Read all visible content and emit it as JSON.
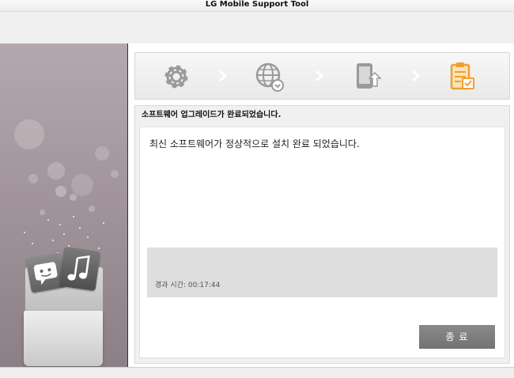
{
  "window": {
    "title": "LG Mobile Support Tool"
  },
  "steps": [
    {
      "icon": "gear-icon",
      "state": "done"
    },
    {
      "icon": "globe-download-icon",
      "state": "done"
    },
    {
      "icon": "phone-upload-icon",
      "state": "done"
    },
    {
      "icon": "clipboard-check-icon",
      "state": "active"
    }
  ],
  "colors": {
    "active_step": "#f0a030",
    "inactive_step": "#9a9a9a",
    "button": "#808080"
  },
  "content": {
    "header": "소프트웨어 업그레이드가 완료되었습니다.",
    "message": "최신 소프트웨어가 정상적으로 설치 완료 되었습니다.",
    "elapsed_label": "경과 시간: 00:17:44"
  },
  "buttons": {
    "finish_label": "종 료"
  }
}
